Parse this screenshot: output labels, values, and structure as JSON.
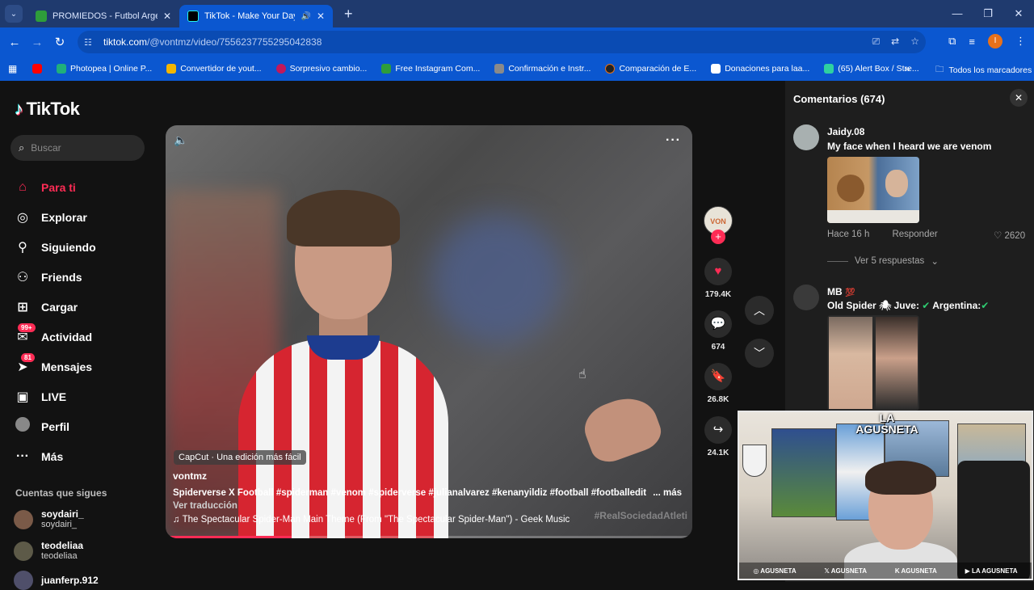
{
  "browser": {
    "tabs": [
      {
        "title": "PROMIEDOS - Futbol Argentino",
        "favicon_color": "#2e9d3a"
      },
      {
        "title": "TikTok - Make Your Day",
        "favicon_color": "#000000"
      }
    ],
    "tab_controls": {
      "close": "✕",
      "new_tab": "+",
      "audio": "🔊",
      "menu": "⌄"
    },
    "window_controls": {
      "minimize": "—",
      "maximize": "❐",
      "close": "✕"
    },
    "url_host": "tiktok.com",
    "url_path": "/@vontmz/video/7556237755295042838",
    "bookmarks": [
      {
        "label": "",
        "color": "#ff0000"
      },
      {
        "label": "Photopea | Online P...",
        "color": "#20b07a"
      },
      {
        "label": "Convertidor de yout...",
        "color": "#f2b600"
      },
      {
        "label": "Sorpresivo cambio...",
        "color": "#c2185b"
      },
      {
        "label": "Free Instagram Com...",
        "color": "#2e9d3a"
      },
      {
        "label": "Confirmación e Instr...",
        "color": "#8a8a8a"
      },
      {
        "label": "Comparación de E...",
        "color": "#222222"
      },
      {
        "label": "Donaciones para laa...",
        "color": "#ffffff"
      },
      {
        "label": "(65) Alert Box / Stre...",
        "color": "#2fd1a0"
      }
    ],
    "bookmarks_more": "»",
    "all_bookmarks": "Todos los marcadores"
  },
  "tiktok": {
    "logo_text": "TikTok",
    "search_placeholder": "Buscar",
    "nav": [
      {
        "label": "Para ti",
        "icon": "home-icon",
        "glyph": "⌂",
        "active": true,
        "badge": ""
      },
      {
        "label": "Explorar",
        "icon": "compass-icon",
        "glyph": "◎",
        "active": false,
        "badge": ""
      },
      {
        "label": "Siguiendo",
        "icon": "following-icon",
        "glyph": "👤",
        "active": false,
        "badge": ""
      },
      {
        "label": "Friends",
        "icon": "friends-icon",
        "glyph": "👥",
        "active": false,
        "badge": ""
      },
      {
        "label": "Cargar",
        "icon": "upload-icon",
        "glyph": "⊞",
        "active": false,
        "badge": ""
      },
      {
        "label": "Actividad",
        "icon": "activity-icon",
        "glyph": "✉",
        "active": false,
        "badge": "99+"
      },
      {
        "label": "Mensajes",
        "icon": "messages-icon",
        "glyph": "➤",
        "active": false,
        "badge": "81"
      },
      {
        "label": "LIVE",
        "icon": "live-icon",
        "glyph": "▣",
        "active": false,
        "badge": ""
      },
      {
        "label": "Perfil",
        "icon": "profile-icon",
        "glyph": "●",
        "active": false,
        "badge": ""
      },
      {
        "label": "Más",
        "icon": "more-icon",
        "glyph": "···",
        "active": false,
        "badge": ""
      }
    ],
    "following_title": "Cuentas que sigues",
    "following": [
      {
        "name": "soydairi_",
        "sub": "soydairi_"
      },
      {
        "name": "teodeliaa",
        "sub": "teodeliaa"
      },
      {
        "name": "juanferp.912",
        "sub": ""
      }
    ],
    "video": {
      "capcut": "CapCut · Una edición más fácil",
      "author": "vontmz",
      "description": "Spiderverse X Football #spiderman #venom #spiderverse #julianalvarez #kenanyildiz #football #footballedit",
      "more": "... más",
      "translate": "Ver traducción",
      "music": "The Spectacular Spider-Man Main Theme (From \"The Spectacular Spider-Man\") - Geek Music",
      "watermark": "#RealSociedadAtleti",
      "progress_fraction": 0.24
    },
    "actions": {
      "avatar_text": "VON",
      "likes": "179.4K",
      "comments": "674",
      "saves": "26.8K",
      "shares": "24.1K"
    },
    "comments_panel": {
      "title": "Comentarios (674)",
      "items": [
        {
          "user": "Jaidy.08",
          "text": "My face when I heard we are venom",
          "time": "Hace 16 h",
          "reply": "Responder",
          "likes": "2620",
          "replies": "Ver 5 respuestas"
        },
        {
          "user": "MB",
          "emoji": "💯",
          "text_parts": [
            "Old Spider",
            "Juve:",
            "Argentina:"
          ]
        }
      ]
    }
  },
  "webcam": {
    "logo": "LA AGUSNETA",
    "socials": [
      "AGUSNETA",
      "AGUSNETA",
      "AGUSNETA",
      "LA AGUSNETA"
    ]
  }
}
